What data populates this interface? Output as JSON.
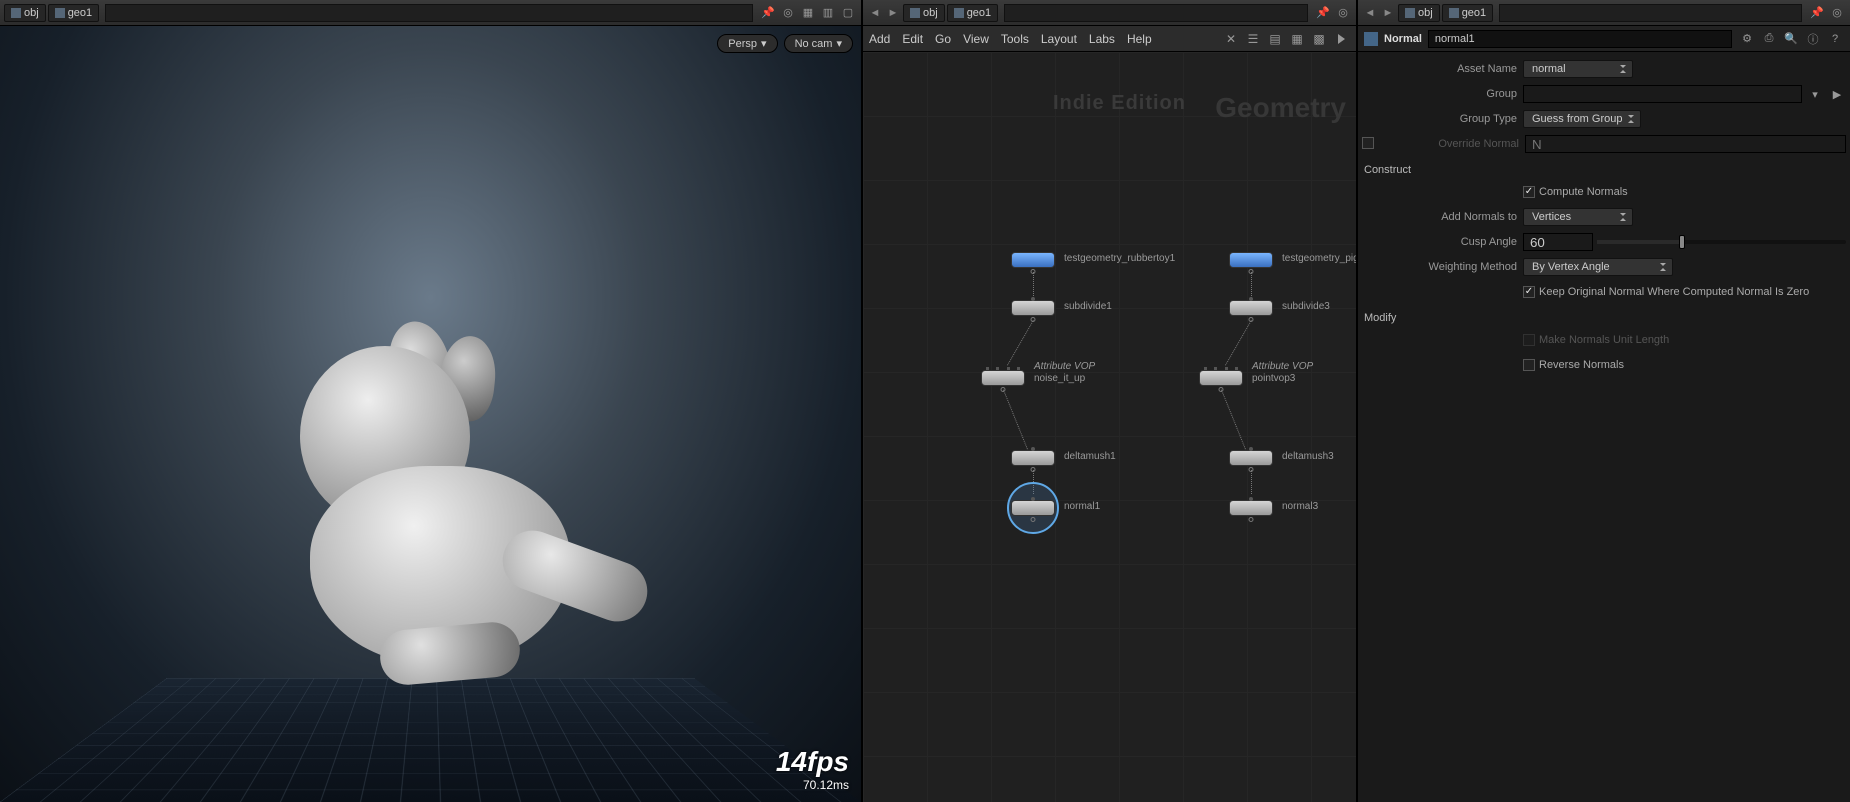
{
  "viewport": {
    "crumbs": [
      "obj",
      "geo1"
    ],
    "persp_label": "Persp",
    "nocam_label": "No cam",
    "fps": "14fps",
    "ms": "70.12ms"
  },
  "network": {
    "crumbs": [
      "obj",
      "geo1"
    ],
    "menu": [
      "Add",
      "Edit",
      "Go",
      "View",
      "Tools",
      "Layout",
      "Labs",
      "Help"
    ],
    "watermark_edition": "Indie Edition",
    "watermark_context": "Geometry",
    "nodes": {
      "left": [
        {
          "name": "testgeometry_rubbertoy1",
          "sub": ""
        },
        {
          "name": "subdivide1",
          "sub": ""
        },
        {
          "name": "noise_it_up",
          "sub": "Attribute VOP"
        },
        {
          "name": "deltamush1",
          "sub": ""
        },
        {
          "name": "normal1",
          "sub": ""
        }
      ],
      "right": [
        {
          "name": "testgeometry_pighe",
          "sub": ""
        },
        {
          "name": "subdivide3",
          "sub": ""
        },
        {
          "name": "pointvop3",
          "sub": "Attribute VOP"
        },
        {
          "name": "deltamush3",
          "sub": ""
        },
        {
          "name": "normal3",
          "sub": ""
        }
      ]
    }
  },
  "params": {
    "crumbs": [
      "obj",
      "geo1"
    ],
    "node_type": "Normal",
    "node_name": "normal1",
    "asset_name_label": "Asset Name",
    "asset_name_value": "normal",
    "group_label": "Group",
    "group_value": "",
    "group_type_label": "Group Type",
    "group_type_value": "Guess from Group",
    "override_label": "Override Normal",
    "override_placeholder": "N",
    "section_construct": "Construct",
    "compute_label": "Compute Normals",
    "add_to_label": "Add Normals to",
    "add_to_value": "Vertices",
    "cusp_label": "Cusp Angle",
    "cusp_value": "60",
    "cusp_slider_pct": 33,
    "weight_label": "Weighting Method",
    "weight_value": "By Vertex Angle",
    "keep_label": "Keep Original Normal Where Computed Normal Is Zero",
    "section_modify": "Modify",
    "unit_label": "Make Normals Unit Length",
    "reverse_label": "Reverse Normals"
  }
}
